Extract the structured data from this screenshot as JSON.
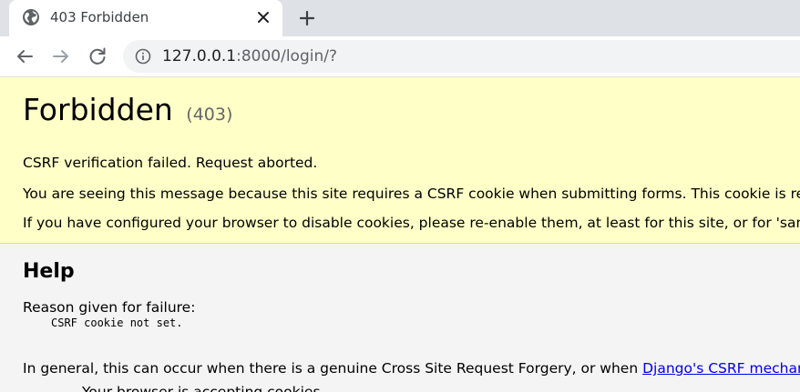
{
  "browser": {
    "tab_title": "403 Forbidden",
    "url_host": "127.0.0.1",
    "url_path": ":8000/login/?"
  },
  "icons": {
    "tab_favicon": "globe-icon",
    "tab_close": "close-icon",
    "new_tab": "plus-icon",
    "back": "back-arrow-icon",
    "forward": "forward-arrow-icon",
    "reload": "reload-icon",
    "site_info": "info-icon"
  },
  "colors": {
    "summary_background": "#ffffc8",
    "page_background": "#f4f4f4",
    "link": "#0000ee"
  },
  "summary": {
    "title": "Forbidden",
    "status_code": "(403)",
    "message": "CSRF verification failed. Request aborted.",
    "explanation": "You are seeing this message because this site requires a CSRF cookie when submitting forms. This cookie is re",
    "cookies_hint": "If you have configured your browser to disable cookies, please re-enable them, at least for this site, or for 'sam"
  },
  "help": {
    "title": "Help",
    "reason_label": "Reason given for failure:",
    "reason_value": "CSRF cookie not set.",
    "general_prefix": "In general, this can occur when there is a genuine Cross Site Request Forgery, or when ",
    "general_link": "Django's CSRF mechani",
    "list_item_partial": "Your browser is accepting cookies."
  }
}
